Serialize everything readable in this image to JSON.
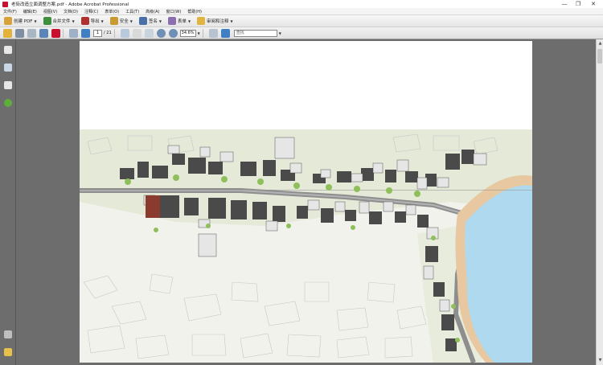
{
  "window": {
    "title": "老街改造立面调整方案.pdf - Adobe Acrobat Professional",
    "controls": [
      "—",
      "❐",
      "✕"
    ]
  },
  "menubar": {
    "items": [
      "文件(F)",
      "编辑(E)",
      "视图(V)",
      "文档(D)",
      "注释(C)",
      "表单(O)",
      "工具(T)",
      "高级(A)",
      "窗口(W)",
      "帮助(H)"
    ]
  },
  "toolbar1": {
    "create_pdf": "创建 PDF",
    "combine_files": "合并文件",
    "export": "导出",
    "secure": "安全",
    "sign": "签名",
    "forms": "表单",
    "review_comment": "审阅和注释"
  },
  "toolbar2": {
    "page_current": "1",
    "page_total": "/ 21",
    "zoom": "34.6%",
    "find_placeholder": "查找"
  },
  "colors": {
    "background": "#6d6d6d",
    "water": "#aed9ee",
    "road": "#8e8e8e",
    "accent": "#c8102e"
  }
}
